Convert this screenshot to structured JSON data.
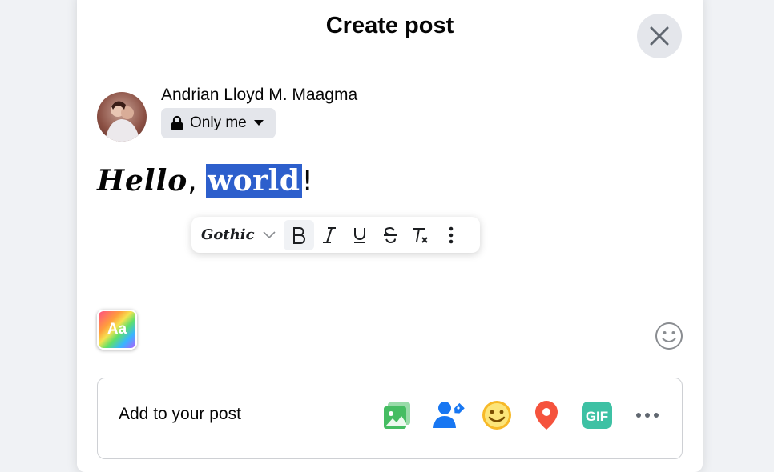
{
  "dialog": {
    "title": "Create post",
    "close_icon": "close-icon"
  },
  "user": {
    "name": "Andrian Lloyd M. Maagma",
    "privacy_label": "Only me",
    "privacy_icon": "lock-icon"
  },
  "editor": {
    "text_part1": "Hello",
    "text_part2": ", ",
    "selected_text": "world",
    "text_part3": "!"
  },
  "format_toolbar": {
    "font_label": "Gothic",
    "buttons": [
      "bold-icon",
      "italic-icon",
      "underline-icon",
      "strikethrough-icon",
      "clear-format-icon",
      "more-vertical-icon"
    ]
  },
  "background_button": {
    "label": "Aa"
  },
  "add_to_post": {
    "label": "Add to your post",
    "icons": [
      "photo-video-icon",
      "tag-people-icon",
      "feeling-icon",
      "check-in-icon",
      "gif-icon",
      "more-icon"
    ]
  },
  "colors": {
    "selection": "#2d5fcc",
    "photo_green": "#45bd62",
    "tag_blue": "#1877f2",
    "feeling_yellow": "#f7b928",
    "checkin_red": "#f5533d",
    "gif_teal": "#3ec1a4"
  }
}
